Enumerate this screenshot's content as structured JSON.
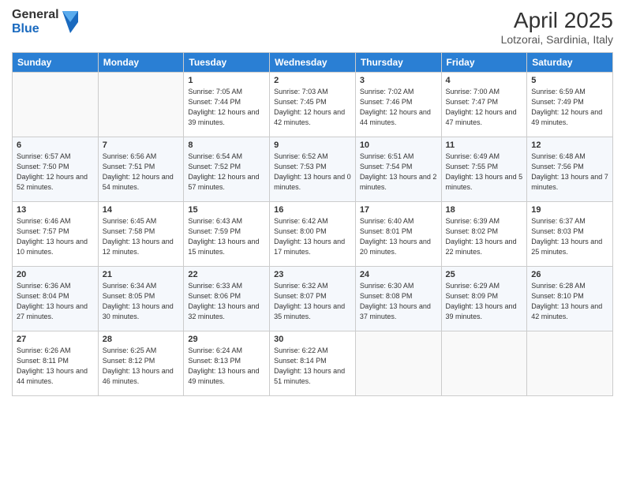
{
  "logo": {
    "general": "General",
    "blue": "Blue"
  },
  "title": "April 2025",
  "subtitle": "Lotzorai, Sardinia, Italy",
  "headers": [
    "Sunday",
    "Monday",
    "Tuesday",
    "Wednesday",
    "Thursday",
    "Friday",
    "Saturday"
  ],
  "weeks": [
    [
      {
        "day": "",
        "info": ""
      },
      {
        "day": "",
        "info": ""
      },
      {
        "day": "1",
        "info": "Sunrise: 7:05 AM\nSunset: 7:44 PM\nDaylight: 12 hours and 39 minutes."
      },
      {
        "day": "2",
        "info": "Sunrise: 7:03 AM\nSunset: 7:45 PM\nDaylight: 12 hours and 42 minutes."
      },
      {
        "day": "3",
        "info": "Sunrise: 7:02 AM\nSunset: 7:46 PM\nDaylight: 12 hours and 44 minutes."
      },
      {
        "day": "4",
        "info": "Sunrise: 7:00 AM\nSunset: 7:47 PM\nDaylight: 12 hours and 47 minutes."
      },
      {
        "day": "5",
        "info": "Sunrise: 6:59 AM\nSunset: 7:49 PM\nDaylight: 12 hours and 49 minutes."
      }
    ],
    [
      {
        "day": "6",
        "info": "Sunrise: 6:57 AM\nSunset: 7:50 PM\nDaylight: 12 hours and 52 minutes."
      },
      {
        "day": "7",
        "info": "Sunrise: 6:56 AM\nSunset: 7:51 PM\nDaylight: 12 hours and 54 minutes."
      },
      {
        "day": "8",
        "info": "Sunrise: 6:54 AM\nSunset: 7:52 PM\nDaylight: 12 hours and 57 minutes."
      },
      {
        "day": "9",
        "info": "Sunrise: 6:52 AM\nSunset: 7:53 PM\nDaylight: 13 hours and 0 minutes."
      },
      {
        "day": "10",
        "info": "Sunrise: 6:51 AM\nSunset: 7:54 PM\nDaylight: 13 hours and 2 minutes."
      },
      {
        "day": "11",
        "info": "Sunrise: 6:49 AM\nSunset: 7:55 PM\nDaylight: 13 hours and 5 minutes."
      },
      {
        "day": "12",
        "info": "Sunrise: 6:48 AM\nSunset: 7:56 PM\nDaylight: 13 hours and 7 minutes."
      }
    ],
    [
      {
        "day": "13",
        "info": "Sunrise: 6:46 AM\nSunset: 7:57 PM\nDaylight: 13 hours and 10 minutes."
      },
      {
        "day": "14",
        "info": "Sunrise: 6:45 AM\nSunset: 7:58 PM\nDaylight: 13 hours and 12 minutes."
      },
      {
        "day": "15",
        "info": "Sunrise: 6:43 AM\nSunset: 7:59 PM\nDaylight: 13 hours and 15 minutes."
      },
      {
        "day": "16",
        "info": "Sunrise: 6:42 AM\nSunset: 8:00 PM\nDaylight: 13 hours and 17 minutes."
      },
      {
        "day": "17",
        "info": "Sunrise: 6:40 AM\nSunset: 8:01 PM\nDaylight: 13 hours and 20 minutes."
      },
      {
        "day": "18",
        "info": "Sunrise: 6:39 AM\nSunset: 8:02 PM\nDaylight: 13 hours and 22 minutes."
      },
      {
        "day": "19",
        "info": "Sunrise: 6:37 AM\nSunset: 8:03 PM\nDaylight: 13 hours and 25 minutes."
      }
    ],
    [
      {
        "day": "20",
        "info": "Sunrise: 6:36 AM\nSunset: 8:04 PM\nDaylight: 13 hours and 27 minutes."
      },
      {
        "day": "21",
        "info": "Sunrise: 6:34 AM\nSunset: 8:05 PM\nDaylight: 13 hours and 30 minutes."
      },
      {
        "day": "22",
        "info": "Sunrise: 6:33 AM\nSunset: 8:06 PM\nDaylight: 13 hours and 32 minutes."
      },
      {
        "day": "23",
        "info": "Sunrise: 6:32 AM\nSunset: 8:07 PM\nDaylight: 13 hours and 35 minutes."
      },
      {
        "day": "24",
        "info": "Sunrise: 6:30 AM\nSunset: 8:08 PM\nDaylight: 13 hours and 37 minutes."
      },
      {
        "day": "25",
        "info": "Sunrise: 6:29 AM\nSunset: 8:09 PM\nDaylight: 13 hours and 39 minutes."
      },
      {
        "day": "26",
        "info": "Sunrise: 6:28 AM\nSunset: 8:10 PM\nDaylight: 13 hours and 42 minutes."
      }
    ],
    [
      {
        "day": "27",
        "info": "Sunrise: 6:26 AM\nSunset: 8:11 PM\nDaylight: 13 hours and 44 minutes."
      },
      {
        "day": "28",
        "info": "Sunrise: 6:25 AM\nSunset: 8:12 PM\nDaylight: 13 hours and 46 minutes."
      },
      {
        "day": "29",
        "info": "Sunrise: 6:24 AM\nSunset: 8:13 PM\nDaylight: 13 hours and 49 minutes."
      },
      {
        "day": "30",
        "info": "Sunrise: 6:22 AM\nSunset: 8:14 PM\nDaylight: 13 hours and 51 minutes."
      },
      {
        "day": "",
        "info": ""
      },
      {
        "day": "",
        "info": ""
      },
      {
        "day": "",
        "info": ""
      }
    ]
  ]
}
